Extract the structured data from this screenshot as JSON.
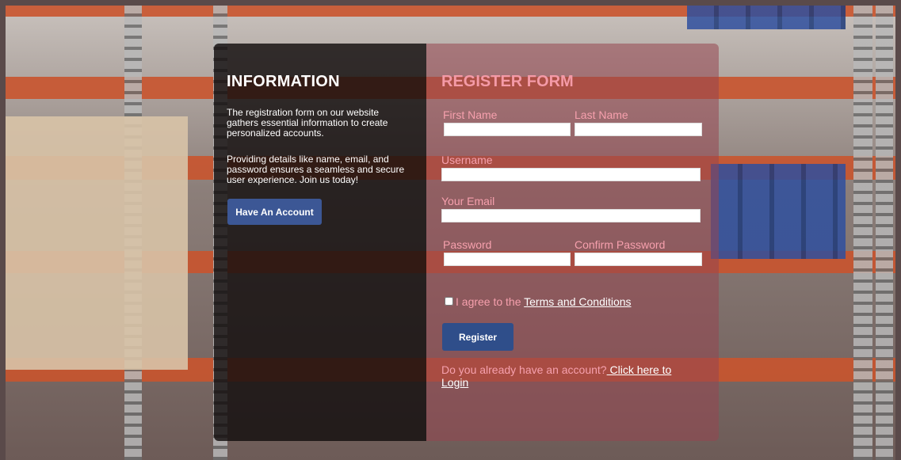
{
  "info": {
    "title": "INFORMATION",
    "paragraph1": "The registration form on our website gathers essential information to create personalized accounts.",
    "paragraph2": "Providing details like name, email, and password ensures a seamless and secure user experience. Join us today!",
    "have_account_button": "Have An Account"
  },
  "register": {
    "title": "REGISTER FORM",
    "first_name_label": "First Name",
    "last_name_label": "Last Name",
    "username_label": "Username",
    "email_label": "Your Email",
    "password_label": "Password",
    "confirm_password_label": "Confirm Password",
    "agree_text": "I agree to the ",
    "terms_link": "Terms and Conditions",
    "register_button": "Register",
    "login_prompt": "Do you already have an account?",
    "login_link": " Click here to Login"
  },
  "colors": {
    "accent": "#f49aa7",
    "button": "#3c5795",
    "info_panel": "#120e0e",
    "beam": "#c9542d"
  }
}
